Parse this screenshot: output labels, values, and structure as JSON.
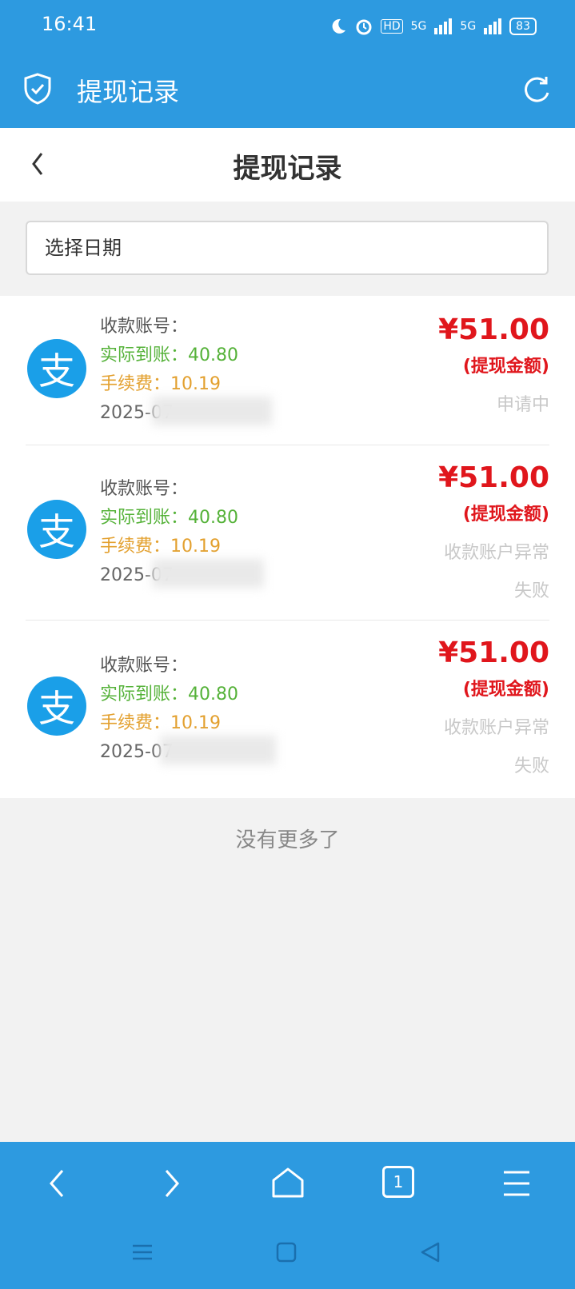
{
  "status_bar": {
    "time": "16:41",
    "hd": "HD",
    "sig1": "5G",
    "sig2": "5G",
    "battery": "83"
  },
  "app_bar": {
    "title": "提现记录",
    "icons": [
      "shield-check-icon",
      "refresh-icon"
    ]
  },
  "page": {
    "title": "提现记录",
    "date_placeholder": "选择日期"
  },
  "records": [
    {
      "account": "收款账号：",
      "actual": "实际到账：40.80",
      "fee": "手续费：10.19",
      "date": "2025-07",
      "amount": "¥51.00",
      "amount_tag": "(提现金额)",
      "status1": "申请中",
      "status2": ""
    },
    {
      "account": "收款账号：",
      "actual": "实际到账：40.80",
      "fee": "手续费：10.19",
      "date": "2025-07",
      "amount": "¥51.00",
      "amount_tag": "(提现金额)",
      "status1": "收款账户异常",
      "status2": "失败"
    },
    {
      "account": "收款账号：",
      "actual": "实际到账：40.80",
      "fee": "手续费：10.19",
      "date": "2025-07",
      "amount": "¥51.00",
      "amount_tag": "(提现金额)",
      "status1": "收款账户异常",
      "status2": "失败"
    }
  ],
  "footer": {
    "no_more": "没有更多了"
  },
  "browser_nav": {
    "tab_count": "1"
  }
}
